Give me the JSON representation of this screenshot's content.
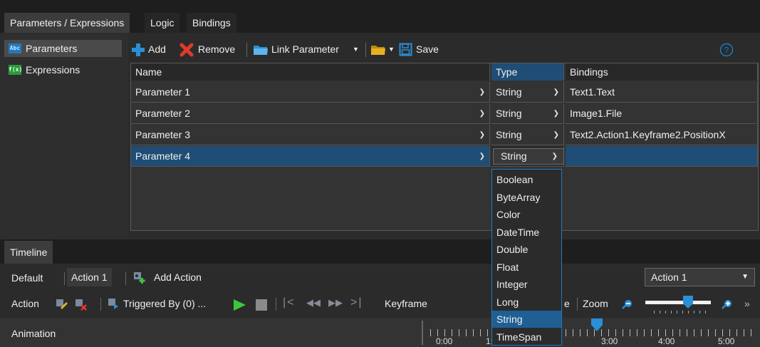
{
  "top_tabs": [
    {
      "label": "Parameters / Expressions",
      "active": true
    },
    {
      "label": "Logic",
      "active": false
    },
    {
      "label": "Bindings",
      "active": false
    }
  ],
  "left_panel": {
    "items": [
      {
        "label": "Parameters",
        "icon": "parameters-icon",
        "icon_text": "Abc",
        "selected": true
      },
      {
        "label": "Expressions",
        "icon": "expressions-icon",
        "icon_text": "f(x)",
        "selected": false
      }
    ]
  },
  "toolbar": {
    "add_label": "Add",
    "remove_label": "Remove",
    "link_parameter_label": "Link Parameter",
    "save_label": "Save"
  },
  "grid": {
    "columns": [
      "Name",
      "Type",
      "Bindings"
    ],
    "rows": [
      {
        "name": "Parameter 1",
        "type": "String",
        "binding": "Text1.Text"
      },
      {
        "name": "Parameter 2",
        "type": "String",
        "binding": "Image1.File"
      },
      {
        "name": "Parameter 3",
        "type": "String",
        "binding": "Text2.Action1.Keyframe2.PositionX"
      },
      {
        "name": "Parameter 4",
        "type": "String",
        "binding": ""
      }
    ]
  },
  "type_dropdown": {
    "options": [
      "Boolean",
      "ByteArray",
      "Color",
      "DateTime",
      "Double",
      "Float",
      "Integer",
      "Long",
      "String",
      "TimeSpan"
    ],
    "selected": "String"
  },
  "timeline": {
    "tab_label": "Timeline",
    "tabs": [
      {
        "label": "Default",
        "active": false
      },
      {
        "label": "Action 1",
        "active": true
      }
    ],
    "add_action_label": "Add Action",
    "action_select_value": "Action 1",
    "action_label": "Action",
    "triggered_by_label": "Triggered By (0) ...",
    "keyframe_label": "Keyframe",
    "partial_e": "e",
    "zoom_label": "Zoom",
    "animation_label": "Animation",
    "time_labels": [
      "0:00",
      "1:",
      "3:00",
      "4:00",
      "5:00"
    ]
  },
  "colors": {
    "accent": "#1f7ac0",
    "selection": "#1f4d75",
    "play": "#3cc83c",
    "remove": "#e03a2a",
    "folder": "#2a8fd6",
    "yellow_folder": "#e8b020"
  }
}
